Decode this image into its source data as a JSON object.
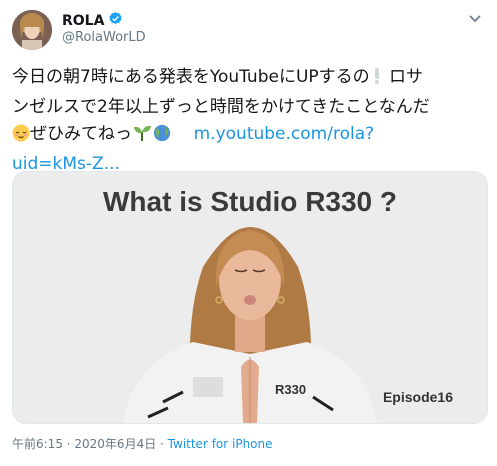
{
  "user": {
    "name": "ROLA",
    "handle": "@RolaWorLD"
  },
  "tweet": {
    "text_line1": "今日の朝7時にある発表をYouTubeにUPするの",
    "text_line1_end": "ロサ",
    "text_line2": "ンゼルスで2年以上ずっと時間をかけてきたことなんだ",
    "text_line3": "ぜひみてねっ",
    "link_line1": "m.youtube.com/rola?",
    "link_line2": "uid=kMs-Z..."
  },
  "media": {
    "title": "What is Studio R330 ?",
    "episode": "Episode16"
  },
  "footer": {
    "timestamp": "午前6:15 · 2020年6月4日",
    "separator": " · ",
    "source": "Twitter for iPhone"
  },
  "colors": {
    "link": "#1b95e0",
    "verified": "#1da1f2",
    "muted": "#657786"
  },
  "icons": [
    "verified-badge-icon",
    "chevron-down-icon",
    "exclamation-icon",
    "relieved-face-icon",
    "seedling-icon",
    "globe-icon"
  ]
}
